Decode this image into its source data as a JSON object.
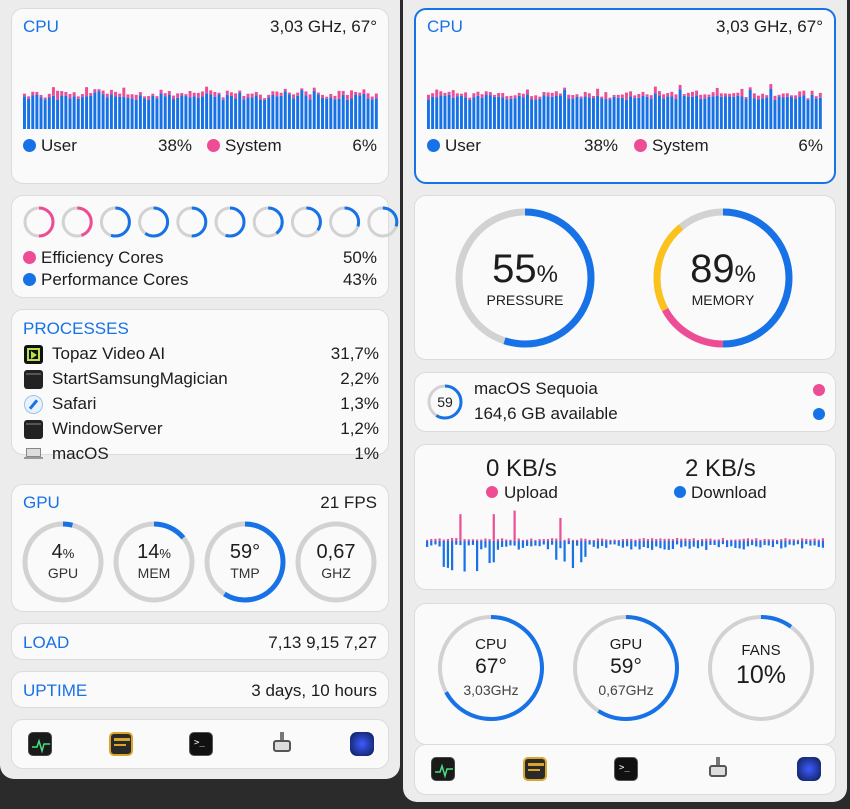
{
  "left": {
    "cpu": {
      "title": "CPU",
      "info": "3,03 GHz, 67°",
      "user_label": "User",
      "user_value": "38%",
      "system_label": "System",
      "system_value": "6%"
    },
    "cores": {
      "rings": [
        0.5,
        0.45,
        0.55,
        0.6,
        0.5,
        0.55,
        0.4,
        0.35,
        0.3,
        0.3
      ],
      "efficiency_label": "Efficiency Cores",
      "efficiency_value": "50%",
      "performance_label": "Performance Cores",
      "performance_value": "43%"
    },
    "processes": {
      "title": "PROCESSES",
      "items": [
        {
          "name": "Topaz Video AI",
          "value": "31,7%",
          "icon": "topaz-icon"
        },
        {
          "name": "StartSamsungMagician",
          "value": "2,2%",
          "icon": "terminal-app-icon"
        },
        {
          "name": "Safari",
          "value": "1,3%",
          "icon": "safari-icon"
        },
        {
          "name": "WindowServer",
          "value": "1,2%",
          "icon": "terminal-app-icon"
        },
        {
          "name": "macOS",
          "value": "1%",
          "icon": "macbook-icon"
        }
      ]
    },
    "gpu": {
      "title": "GPU",
      "fps": "21 FPS",
      "gauges": [
        {
          "value": "4",
          "unit": "%",
          "label": "GPU",
          "level": 0.04
        },
        {
          "value": "14",
          "unit": "%",
          "label": "MEM",
          "level": 0.14
        },
        {
          "value": "59°",
          "unit": "",
          "label": "TMP",
          "level": 0.59
        },
        {
          "value": "0,67",
          "unit": "",
          "label": "GHZ",
          "level": 0
        }
      ]
    },
    "load": {
      "title": "LOAD",
      "value": "7,13 9,15 7,27"
    },
    "uptime": {
      "title": "UPTIME",
      "value": "3 days, 10 hours"
    },
    "dock": [
      "activity-monitor-icon",
      "console-icon",
      "terminal-icon",
      "cleaner-icon",
      "speedometer-icon"
    ]
  },
  "right": {
    "cpu": {
      "title": "CPU",
      "info": "3,03 GHz, 67°",
      "user_label": "User",
      "user_value": "38%",
      "system_label": "System",
      "system_value": "6%"
    },
    "memory": {
      "pressure_value": "55",
      "pressure_unit": "%",
      "pressure_label": "PRESSURE",
      "pressure_level": 0.55,
      "memory_value": "89",
      "memory_unit": "%",
      "memory_label": "MEMORY",
      "memory_level": 0.89
    },
    "disk": {
      "badge": "59",
      "name": "macOS Sequoia",
      "available": "164,6 GB available"
    },
    "network": {
      "upload_value": "0 KB/s",
      "upload_label": "Upload",
      "download_value": "2 KB/s",
      "download_label": "Download"
    },
    "sensors": [
      {
        "label": "CPU",
        "value": "67°",
        "sub": "3,03GHz",
        "level": 0.67
      },
      {
        "label": "GPU",
        "value": "59°",
        "sub": "0,67GHz",
        "level": 0.59
      },
      {
        "label": "FANS",
        "value": "10%",
        "sub": "",
        "level": 0.1
      }
    ],
    "dock": [
      "activity-monitor-icon",
      "console-icon",
      "terminal-icon",
      "cleaner-icon",
      "speedometer-icon"
    ]
  },
  "colors": {
    "accent": "#1672e6",
    "system": "#ec4d95",
    "memory_yellow": "#fbc21c",
    "track": "#d2d2d2"
  }
}
